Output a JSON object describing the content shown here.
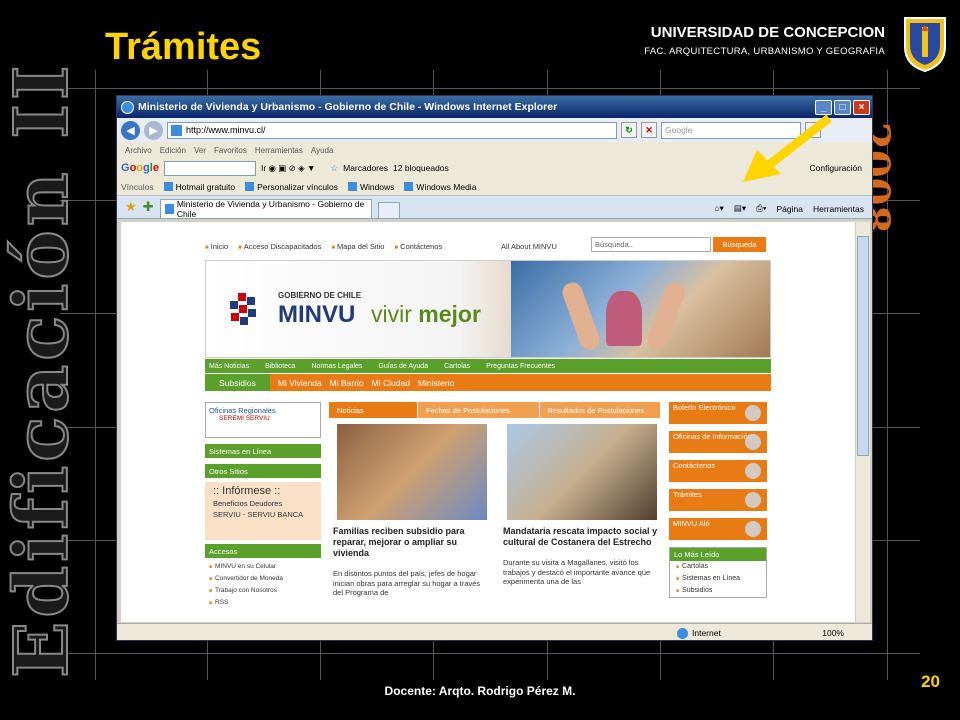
{
  "slide": {
    "title": "Trámites",
    "university": "UNIVERSIDAD DE CONCEPCION",
    "faculty": "FAC. ARQUITECTURA, URBANISMO Y GEOGRAFIA",
    "vertical_title": "Edificación II",
    "year": "2008",
    "page_number": "20",
    "instructor": "Docente: Arqto. Rodrigo Pérez M."
  },
  "browser": {
    "window_title": "Ministerio de Vivienda y Urbanismo - Gobierno de Chile - Windows Internet Explorer",
    "address": "http://www.minvu.cl/",
    "search_placeholder": "Google",
    "menu": [
      "Archivo",
      "Edición",
      "Ver",
      "Favoritos",
      "Herramientas",
      "Ayuda"
    ],
    "google_toolbar": {
      "bookmarks": "Marcadores",
      "blocked": "12 bloqueados",
      "settings": "Configuración"
    },
    "links_label": "Vínculos",
    "links": [
      "Hotmail gratuito",
      "Personalizar vínculos",
      "Windows",
      "Windows Media"
    ],
    "tab_title": "Ministerio de Vivienda y Urbanismo - Gobierno de Chile",
    "tools": {
      "page": "Página",
      "tools": "Herramientas"
    },
    "status_zone": "Internet",
    "zoom": "100%"
  },
  "site": {
    "top_links": [
      "Inicio",
      "Acceso Discapacitados",
      "Mapa del Sitio",
      "Contáctenos"
    ],
    "about": "All About MINVU",
    "search_placeholder": "Búsqueda..",
    "search_button": "Búsqueda",
    "brand": {
      "gov": "GOBIERNO DE CHILE",
      "name": "MINVU",
      "slogan_a": "vivir",
      "slogan_b": "mejor"
    },
    "nav1": [
      "Más Noticias",
      "Biblioteca",
      "Normas Legales",
      "Guías de Ayuda",
      "Cartolas",
      "Preguntas Frecuentes"
    ],
    "nav2": [
      "Subsidios",
      "Mi Vivienda",
      "Mi Barrio",
      "Mi Ciudad",
      "Ministerio"
    ],
    "left": {
      "oficinas": "Oficinas Regionales",
      "seremi": "SEREMI SERVIU",
      "sistemas": "Sistemas en Línea",
      "otros": "Otros Sitios",
      "informese": ":: Infórmese ::",
      "informese_sub1": "Beneficios Deudores",
      "informese_sub2": "SERVIU - SERVIU BANCA",
      "accesos": "Accesos",
      "accesos_items": [
        "MINVU en su Celular",
        "Convertidor de Moneda",
        "Trabajo con Nosotros",
        "RSS"
      ]
    },
    "tabs": [
      "Noticias",
      "Fechas de Postulaciones",
      "Resultados de Postulaciones"
    ],
    "news": [
      {
        "headline": "Familias reciben subsidio para reparar, mejorar o ampliar su vivienda",
        "text": "En distintos puntos del país, jefes de hogar inician obras para  arreglar su hogar a través del Programa de"
      },
      {
        "headline": "Mandataria rescata impacto social y cultural de Costanera del Estrecho",
        "text": "Durante su visita a Magallanes, visitó los trabajos y destacó el importante avance que experimenta una de las"
      }
    ],
    "right": {
      "buttons": [
        "Boletín Electrónico",
        "Oficinas de Información",
        "Contáctenos",
        "Trámites",
        "MINVU Aló"
      ],
      "lo_mas": "Lo Más Leído",
      "lo_mas_items": [
        "Cartolas",
        "Sistemas en Línea",
        "Subsidios"
      ]
    }
  }
}
